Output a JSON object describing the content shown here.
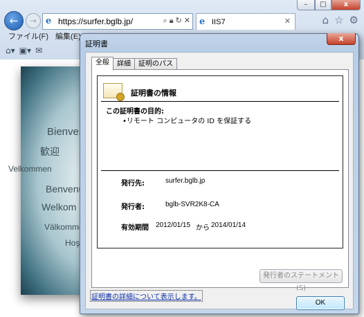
{
  "browser": {
    "url": "https://surfer.bglb.jp/",
    "tab_title": "IIS7",
    "menu": [
      "ファイル(F)",
      "編集(E)"
    ],
    "icons": [
      "back-icon",
      "forward-icon",
      "search-icon",
      "lock-icon",
      "refresh-icon",
      "close-icon",
      "home-icon",
      "star-icon",
      "gear-icon",
      "rss-icon",
      "mail-icon"
    ]
  },
  "page": {
    "welcome_texts": [
      "Bienvenido",
      "歓迎",
      "Velkommen",
      "Benvenuto",
      "Welkom",
      "Välkommen",
      "Hoş"
    ]
  },
  "dialog": {
    "title": "証明書",
    "close_label": "x",
    "tabs": [
      "全般",
      "詳細",
      "証明のパス"
    ],
    "info_title": "証明書の情報",
    "purpose_heading": "この証明書の目的:",
    "purpose_item": "•リモート コンピュータの ID を保証する",
    "issued_to_label": "発行先:",
    "issued_to_value": "surfer.bglb.jp",
    "issued_by_label": "発行者:",
    "issued_by_value": "bglb-SVR2K8-CA",
    "validity_label": "有効期間",
    "valid_from": "2012/01/15",
    "valid_sep": "から",
    "valid_to": "2014/01/14",
    "statement_button": "発行者のステートメント(S)",
    "details_link": "証明書の詳細について表示します。",
    "ok_button": "OK"
  }
}
